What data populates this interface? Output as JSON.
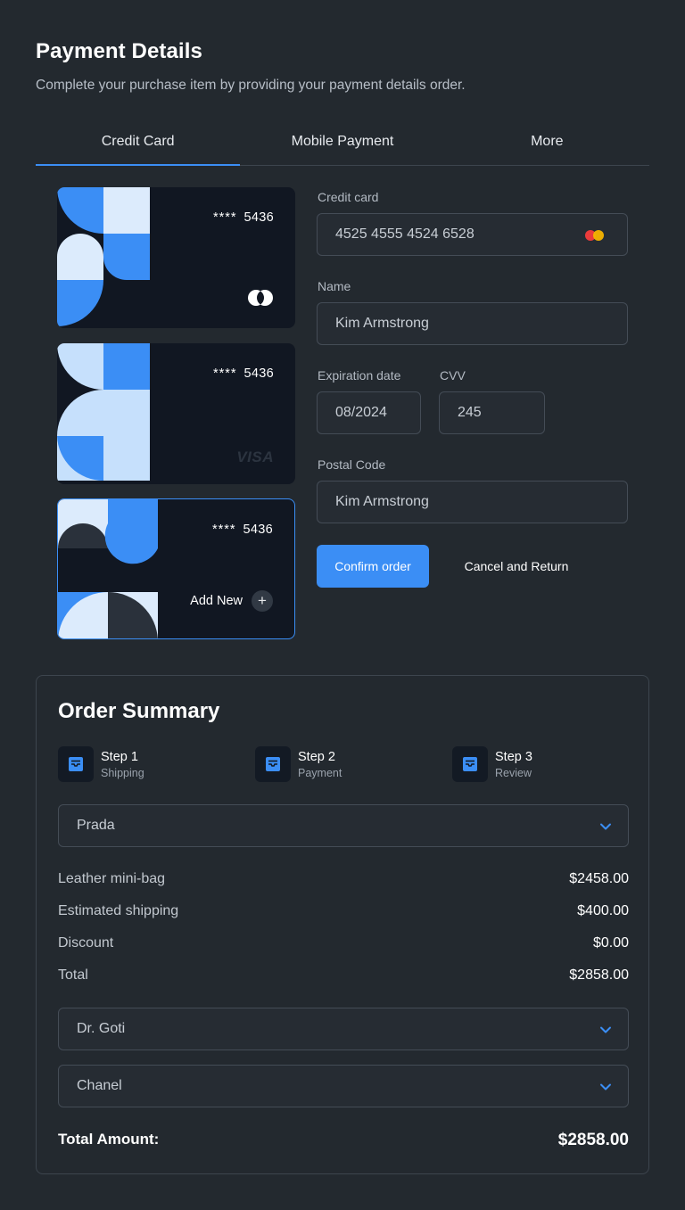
{
  "header": {
    "title": "Payment Details",
    "subtitle": "Complete your purchase item by providing your payment details order."
  },
  "tabs": [
    {
      "label": "Credit Card",
      "active": true
    },
    {
      "label": "Mobile Payment",
      "active": false
    },
    {
      "label": "More",
      "active": false
    }
  ],
  "cards": [
    {
      "masked": "****",
      "last4": "5436",
      "brand": "mastercard-icon"
    },
    {
      "masked": "****",
      "last4": "5436",
      "brand": "VISA"
    },
    {
      "masked": "****",
      "last4": "5436",
      "add_new_label": "Add New",
      "selected": true
    }
  ],
  "form": {
    "card_label": "Credit card",
    "card_value": "4525 4555 4524 6528",
    "name_label": "Name",
    "name_value": "Kim Armstrong",
    "expiry_label": "Expiration date",
    "expiry_value": "08/2024",
    "cvv_label": "CVV",
    "cvv_value": "245",
    "postal_label": "Postal Code",
    "postal_value": "Kim Armstrong",
    "confirm_label": "Confirm order",
    "cancel_label": "Cancel and Return"
  },
  "summary": {
    "title": "Order Summary",
    "steps": [
      {
        "title": "Step 1",
        "subtitle": "Shipping"
      },
      {
        "title": "Step 2",
        "subtitle": "Payment"
      },
      {
        "title": "Step 3",
        "subtitle": "Review"
      }
    ],
    "select_1": "Prada",
    "items": [
      {
        "label": "Leather mini-bag",
        "value": "$2458.00"
      },
      {
        "label": "Estimated shipping",
        "value": "$400.00"
      },
      {
        "label": "Discount",
        "value": "$0.00"
      },
      {
        "label": "Total",
        "value": "$2858.00"
      }
    ],
    "select_2": "Dr. Goti",
    "select_3": "Chanel",
    "total_label": "Total Amount:",
    "total_value": "$2858.00"
  },
  "colors": {
    "background": "#23292f",
    "accent": "#3b8ef5",
    "card_bg": "#111722"
  }
}
